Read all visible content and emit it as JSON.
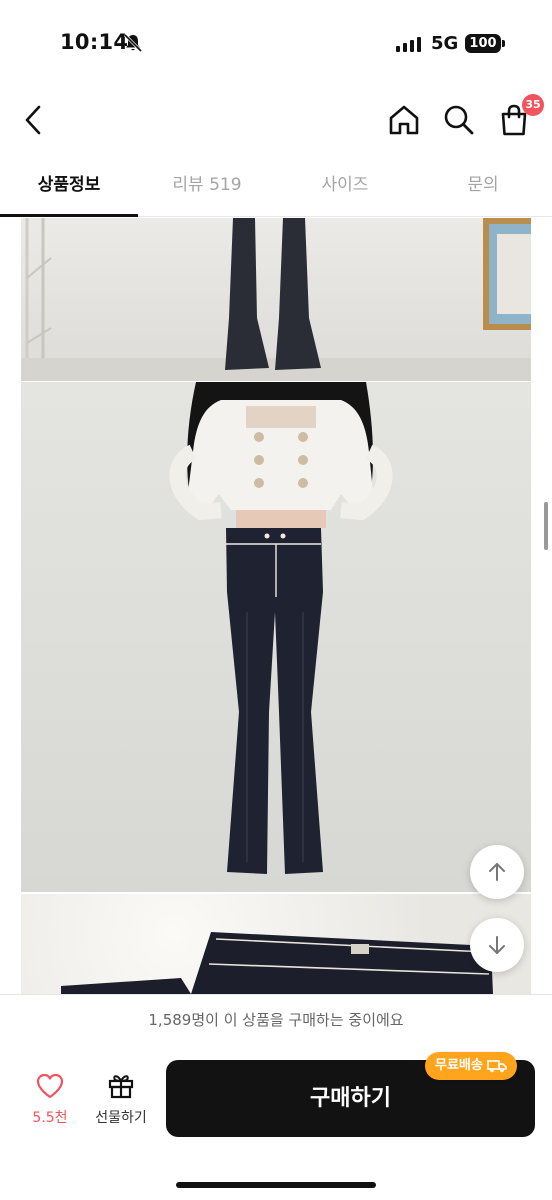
{
  "status_bar": {
    "time": "10:14",
    "network": "5G",
    "battery": "100"
  },
  "header": {
    "back_icon": "chevron-left-icon",
    "home_icon": "home-icon",
    "search_icon": "search-icon",
    "cart_icon": "shopping-bag-icon",
    "cart_count": "35",
    "badge_color": "#f2545f"
  },
  "tabs": [
    {
      "label": "상품정보",
      "active": true
    },
    {
      "label": "리뷰 519",
      "active": false
    },
    {
      "label": "사이즈",
      "active": false
    },
    {
      "label": "문의",
      "active": false
    }
  ],
  "purchase_notice": "1,589명이 이 상품을 구매하는 중이에요",
  "bottom_bar": {
    "like_count": "5.5천",
    "gift_label": "선물하기",
    "buy_label": "구매하기",
    "free_shipping_label": "무료배송",
    "accent_color": "#f2545f",
    "shipping_badge_color": "#ffa41c"
  }
}
